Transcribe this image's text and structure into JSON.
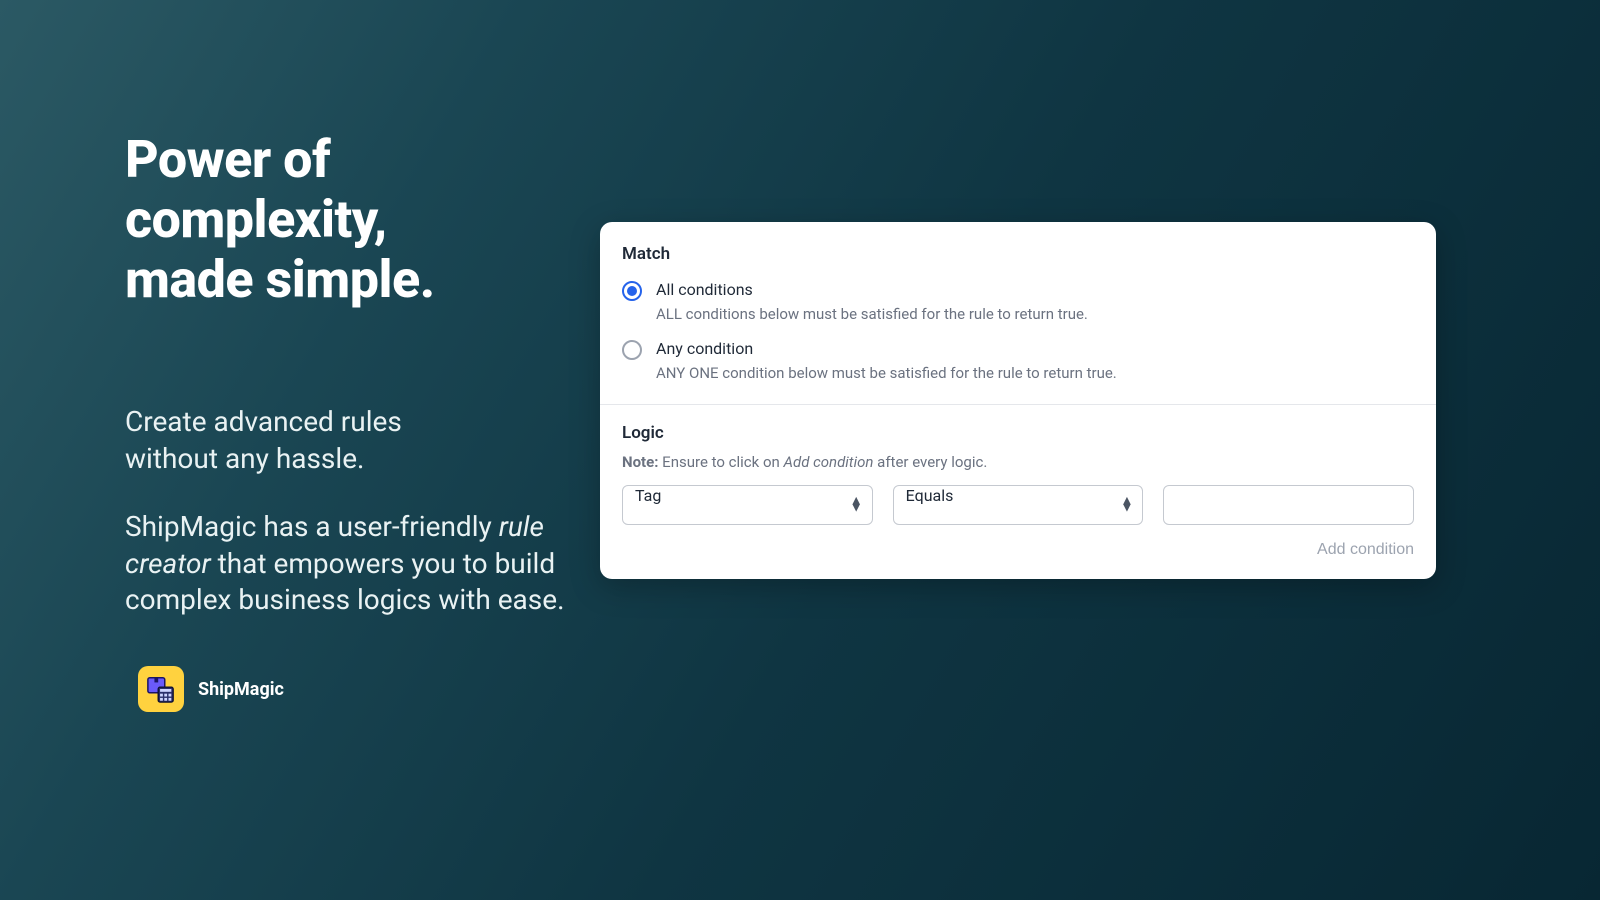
{
  "hero": {
    "headline_l1": "Power of complexity,",
    "headline_l2": "made simple.",
    "lead_l1": "Create advanced rules",
    "lead_l2": "without any hassle.",
    "body_prefix": "ShipMagic has a user-friendly ",
    "body_em": "rule creator",
    "body_suffix": " that empowers you to build complex business logics with ease."
  },
  "brand": {
    "name": "ShipMagic"
  },
  "card": {
    "match": {
      "title": "Match",
      "options": [
        {
          "label": "All conditions",
          "description": "ALL conditions below must be satisfied for the rule to return true.",
          "checked": true
        },
        {
          "label": "Any condition",
          "description": "ANY ONE condition below must be satisfied for the rule to return true.",
          "checked": false
        }
      ]
    },
    "logic": {
      "title": "Logic",
      "note_bold": "Note:",
      "note_before": " Ensure to click on ",
      "note_em": "Add condition",
      "note_after": " after every logic.",
      "row": {
        "field_value": "Tag",
        "operator_value": "Equals",
        "value": ""
      },
      "add_label": "Add condition"
    }
  }
}
